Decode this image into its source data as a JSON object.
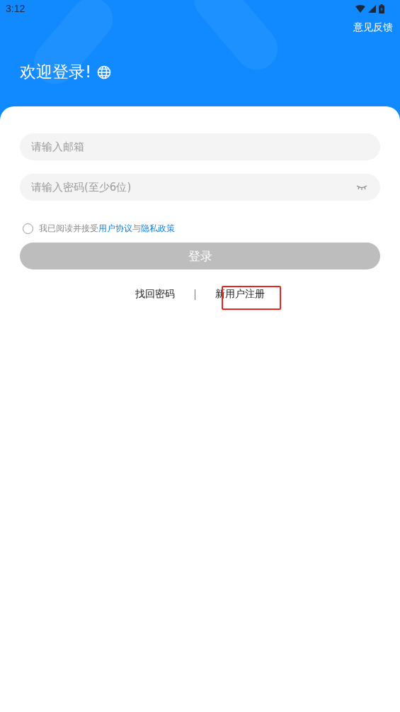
{
  "status_bar": {
    "time": "3:12"
  },
  "header": {
    "feedback": "意见反馈",
    "title": "欢迎登录!"
  },
  "form": {
    "email": {
      "placeholder": "请输入邮箱"
    },
    "password": {
      "placeholder": "请输入密码(至少6位)",
      "visible": false
    },
    "agreement": {
      "checked": false,
      "text": "我已阅读并接受",
      "link_1": "用户协议",
      "joiner": "与",
      "link_2": "隐私政策"
    },
    "login_button": {
      "label": "登录",
      "disabled": true
    },
    "links": [
      "找回密码",
      "新用户注册"
    ]
  }
}
